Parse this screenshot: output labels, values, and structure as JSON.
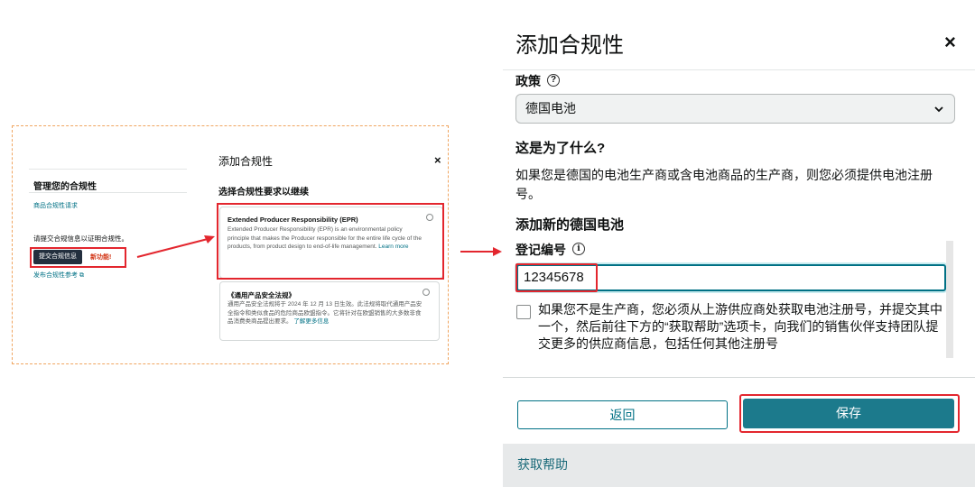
{
  "left_panel": {
    "manage_title": "管理您的合规性",
    "request_link": "商品合规性请求",
    "submit_hint": "请提交合规信息以证明合规性。",
    "submit_button": "提交合规信息",
    "new_feature": "新功能!",
    "publish_link": "发布合规性参考 ⧉"
  },
  "middle_modal": {
    "title": "添加合规性",
    "close": "×",
    "subtitle": "选择合规性要求以继续",
    "options": [
      {
        "title": "Extended Producer Responsibility (EPR)",
        "body": "Extended Producer Responsibility (EPR) is an environmental policy principle that makes the Producer responsible for the entire life cycle of the products, from product design to end-of-life management.",
        "link": "Learn more"
      },
      {
        "title": "《通用产品安全法规》",
        "body": "通用产品安全法规将于 2024 年 12 月 13 日生效。此法规将取代通用产品安全指令和类似食品的危险商品欧盟指令。它将针对在欧盟销售的大多数非食品消费类商品提出要求。",
        "link": "了解更多信息"
      }
    ]
  },
  "modal": {
    "title": "添加合规性",
    "close": "×",
    "policy_label": "政策",
    "help_icon": "?",
    "policy_value": "德国电池",
    "why_title": "这是为了什么?",
    "why_text": "如果您是德国的电池生产商或含电池商品的生产商，则您必须提供电池注册号。",
    "add_title": "添加新的德国电池",
    "reg_label": "登记编号",
    "info_icon": "i",
    "reg_value": "12345678",
    "checkbox_text": "如果您不是生产商，您必须从上游供应商处获取电池注册号，并提交其中一个，然后前往下方的“获取帮助”选项卡，向我们的销售伙伴支持团队提交更多的供应商信息，包括任何其他注册号",
    "back_button": "返回",
    "save_button": "保存",
    "help_bar": "获取帮助"
  },
  "colors": {
    "accent": "#007185",
    "primary_button": "#1c7a8c",
    "highlight": "#e3262e",
    "frame": "#f0a560"
  }
}
